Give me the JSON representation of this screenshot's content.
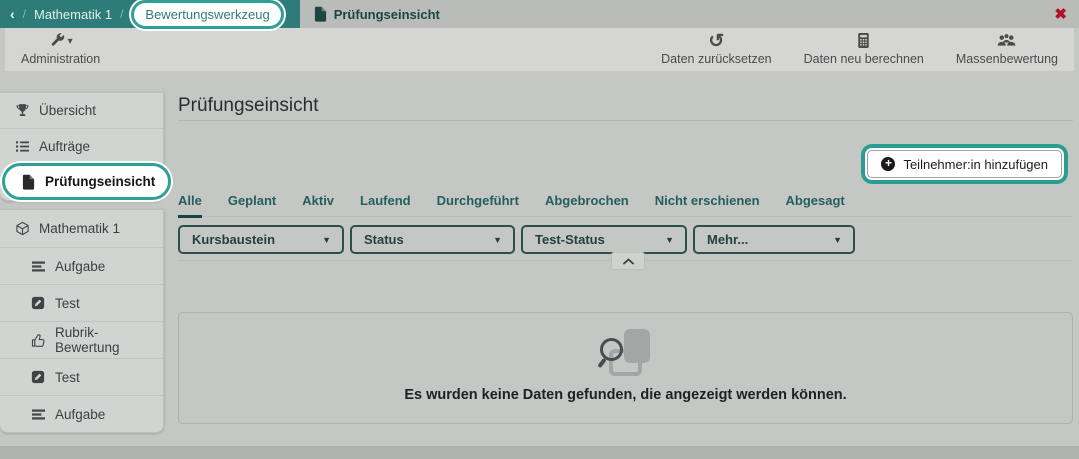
{
  "colors": {
    "accent_teal": "#2d7c79",
    "highlight_ring": "#2fa096",
    "close_red": "#b11226"
  },
  "topbar": {
    "back": "‹",
    "separator": "/",
    "course": "Mathematik 1",
    "highlighted_crumb": "Bewertungswerkzeug",
    "tab": "Prüfungseinsicht",
    "close": "✖"
  },
  "toolbar": {
    "admin": {
      "label": "Administration",
      "caret": "▾"
    },
    "actions": [
      {
        "label": "Daten zurücksetzen",
        "icon": "undo-icon",
        "glyph": "↺"
      },
      {
        "label": "Daten neu berechnen",
        "icon": "calculator-icon"
      },
      {
        "label": "Massenbewertung",
        "icon": "group-icon"
      }
    ]
  },
  "sidebar": {
    "groups": [
      {
        "items": [
          {
            "label": "Übersicht",
            "icon": "trophy-icon"
          },
          {
            "label": "Aufträge",
            "icon": "task-list-icon"
          },
          {
            "label": "Prüfungseinsicht",
            "icon": "document-icon",
            "highlighted": true
          }
        ]
      },
      {
        "items": [
          {
            "label": "Mathematik 1",
            "icon": "cube-icon"
          },
          {
            "label": "Aufgabe",
            "icon": "bars-icon"
          },
          {
            "label": "Test",
            "icon": "test-icon"
          },
          {
            "label": "Rubrik-Bewertung",
            "icon": "thumbs-up-icon"
          },
          {
            "label": "Test",
            "icon": "test-icon"
          },
          {
            "label": "Aufgabe",
            "icon": "bars-icon"
          }
        ]
      }
    ]
  },
  "main": {
    "title": "Prüfungseinsicht",
    "add_button": "Teilnehmer:in hinzufügen",
    "tabs": [
      "Alle",
      "Geplant",
      "Aktiv",
      "Laufend",
      "Durchgeführt",
      "Abgebrochen",
      "Nicht erschienen",
      "Abgesagt"
    ],
    "active_tab": "Alle",
    "filters": [
      "Kursbaustein",
      "Status",
      "Test-Status",
      "Mehr..."
    ],
    "filter_caret": "▼",
    "empty_text": "Es wurden keine Daten gefunden, die angezeigt werden können."
  }
}
